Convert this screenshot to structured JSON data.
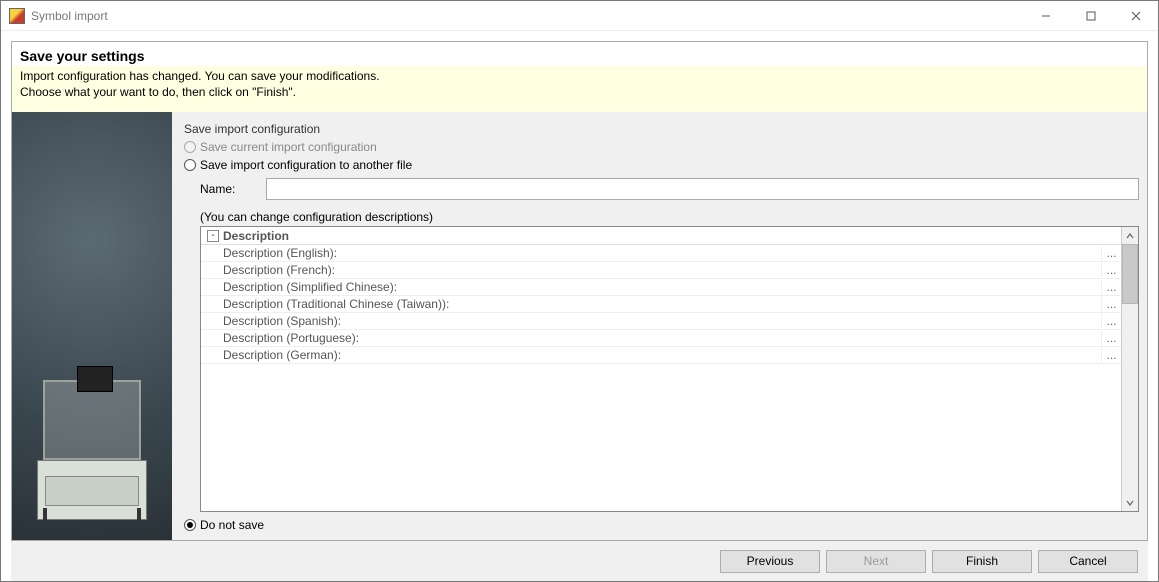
{
  "window": {
    "title": "Symbol import"
  },
  "header": {
    "title": "Save your settings",
    "line1": "Import configuration has changed. You can save your modifications.",
    "line2": "Choose what your want to do, then click on \"Finish\"."
  },
  "form": {
    "group_label": "Save import configuration",
    "opt_save_current": "Save current import configuration",
    "opt_save_another": "Save import configuration to another file",
    "name_label": "Name:",
    "name_value": "",
    "hint": "(You can change configuration descriptions)",
    "grid_header": "Description",
    "tree_btn": "-",
    "do_not_save": "Do not save",
    "rows": [
      "Description (English):",
      "Description (French):",
      "Description (Simplified Chinese):",
      "Description (Traditional Chinese (Taiwan)):",
      "Description (Spanish):",
      "Description (Portuguese):",
      "Description (German):"
    ],
    "more": "..."
  },
  "footer": {
    "previous": "Previous",
    "next": "Next",
    "finish": "Finish",
    "cancel": "Cancel"
  }
}
